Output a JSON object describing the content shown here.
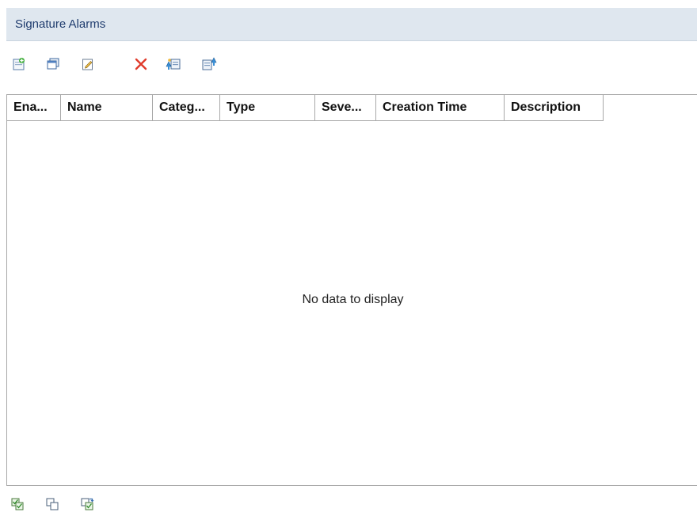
{
  "panel": {
    "title": "Signature Alarms"
  },
  "toolbar": {
    "buttons": [
      {
        "icon": "add-icon"
      },
      {
        "icon": "copy-icon"
      },
      {
        "icon": "edit-icon"
      },
      {
        "icon": "delete-icon"
      },
      {
        "icon": "import-icon"
      },
      {
        "icon": "export-icon"
      }
    ]
  },
  "table": {
    "columns": [
      "Ena...",
      "Name",
      "Categ...",
      "Type",
      "Seve...",
      "Creation Time",
      "Description"
    ],
    "rows": [],
    "empty_message": "No data to display"
  },
  "footer": {
    "buttons": [
      {
        "icon": "select-all-icon"
      },
      {
        "icon": "deselect-icon"
      },
      {
        "icon": "invert-selection-icon"
      }
    ]
  },
  "colors": {
    "titlebar_bg": "#dfe7ef",
    "title_text": "#1f3c6e",
    "grid_border": "#a8a8a8",
    "delete_red": "#e03a2a"
  }
}
